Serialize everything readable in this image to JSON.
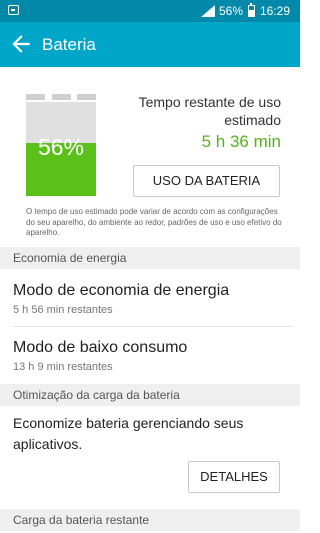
{
  "status_bar": {
    "battery_percent": "56%",
    "time": "16:29",
    "battery_level": 0.56
  },
  "app_bar": {
    "title": "Bateria",
    "back_icon": "arrow-back-icon"
  },
  "battery": {
    "percent_label": "56%",
    "level": 0.56,
    "colors": {
      "charged": "#5bc01a",
      "empty": "#e0e0e0"
    }
  },
  "estimate": {
    "title": "Tempo restante de uso estimado",
    "value": "5 h 36 min",
    "usage_button": "USO DA BATERIA",
    "disclaimer": "O tempo de uso estimado pode variar de acordo com as configurações do seu aparelho, do ambiente ao redor, padrões de uso e uso efetivo do aparelho."
  },
  "power_saving": {
    "header": "Economia de energia",
    "items": [
      {
        "title": "Modo de economia de energia",
        "subtitle": "5 h 56 min restantes"
      },
      {
        "title": "Modo de baixo consumo",
        "subtitle": "13 h 9 min restantes"
      }
    ]
  },
  "optimization": {
    "header": "Otimização da carga da bateria",
    "description": "Economize bateria gerenciando seus aplicativos.",
    "details_button": "DETALHES"
  },
  "remaining": {
    "header": "Carga da bateria restante"
  },
  "colors": {
    "status_bar": "#0288a8",
    "app_bar": "#00a6c8",
    "accent_green": "#55b21a"
  }
}
